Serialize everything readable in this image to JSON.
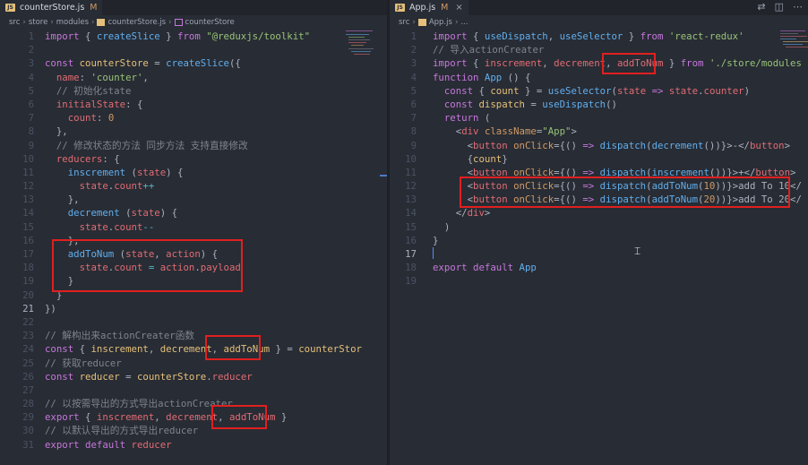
{
  "left": {
    "tab": {
      "badge": "JS",
      "filename": "counterStore.js",
      "modified": "M"
    },
    "breadcrumb": [
      "src",
      "store",
      "modules",
      "counterStore.js",
      "counterStore"
    ],
    "lines": [
      [
        [
          "k",
          "import"
        ],
        [
          "w",
          " { "
        ],
        [
          "f",
          "createSlice"
        ],
        [
          "w",
          " } "
        ],
        [
          "k",
          "from"
        ],
        [
          "w",
          " "
        ],
        [
          "s",
          "\"@reduxjs/toolkit\""
        ]
      ],
      [],
      [
        [
          "k",
          "const"
        ],
        [
          "w",
          " "
        ],
        [
          "y",
          "counterStore"
        ],
        [
          "w",
          " = "
        ],
        [
          "f",
          "createSlice"
        ],
        [
          "w",
          "({"
        ]
      ],
      [
        [
          "w",
          "  "
        ],
        [
          "p",
          "name"
        ],
        [
          "w",
          ": "
        ],
        [
          "s",
          "'counter'"
        ],
        [
          "w",
          ","
        ]
      ],
      [
        [
          "w",
          "  "
        ],
        [
          "c",
          "// 初始化state"
        ]
      ],
      [
        [
          "w",
          "  "
        ],
        [
          "p",
          "initialState"
        ],
        [
          "w",
          ": {"
        ]
      ],
      [
        [
          "w",
          "    "
        ],
        [
          "p",
          "count"
        ],
        [
          "w",
          ": "
        ],
        [
          "n",
          "0"
        ]
      ],
      [
        [
          "w",
          "  },"
        ]
      ],
      [
        [
          "w",
          "  "
        ],
        [
          "c",
          "// 修改状态的方法 同步方法 支持直接修改"
        ]
      ],
      [
        [
          "w",
          "  "
        ],
        [
          "p",
          "reducers"
        ],
        [
          "w",
          ": {"
        ]
      ],
      [
        [
          "w",
          "    "
        ],
        [
          "f",
          "inscrement"
        ],
        [
          "w",
          " ("
        ],
        [
          "p",
          "state"
        ],
        [
          "w",
          ") {"
        ]
      ],
      [
        [
          "w",
          "      "
        ],
        [
          "p",
          "state"
        ],
        [
          "w",
          "."
        ],
        [
          "p",
          "count"
        ],
        [
          "t",
          "++"
        ]
      ],
      [
        [
          "w",
          "    },"
        ]
      ],
      [
        [
          "w",
          "    "
        ],
        [
          "f",
          "decrement"
        ],
        [
          "w",
          " ("
        ],
        [
          "p",
          "state"
        ],
        [
          "w",
          ") {"
        ]
      ],
      [
        [
          "w",
          "      "
        ],
        [
          "p",
          "state"
        ],
        [
          "w",
          "."
        ],
        [
          "p",
          "count"
        ],
        [
          "t",
          "--"
        ]
      ],
      [
        [
          "w",
          "    },"
        ]
      ],
      [
        [
          "w",
          "    "
        ],
        [
          "f",
          "addToNum"
        ],
        [
          "w",
          " ("
        ],
        [
          "p",
          "state"
        ],
        [
          "w",
          ", "
        ],
        [
          "p",
          "action"
        ],
        [
          "w",
          ") {"
        ]
      ],
      [
        [
          "w",
          "      "
        ],
        [
          "p",
          "state"
        ],
        [
          "w",
          "."
        ],
        [
          "p",
          "count"
        ],
        [
          "w",
          " "
        ],
        [
          "t",
          "="
        ],
        [
          "w",
          " "
        ],
        [
          "p",
          "action"
        ],
        [
          "w",
          "."
        ],
        [
          "p",
          "payload"
        ]
      ],
      [
        [
          "w",
          "    }"
        ]
      ],
      [
        [
          "w",
          "  }"
        ]
      ],
      [
        [
          "w",
          "})"
        ]
      ],
      [],
      [
        [
          "c",
          "// 解构出来actionCreater函数"
        ]
      ],
      [
        [
          "k",
          "const"
        ],
        [
          "w",
          " { "
        ],
        [
          "y",
          "inscrement"
        ],
        [
          "w",
          ", "
        ],
        [
          "y",
          "decrement"
        ],
        [
          "w",
          ", "
        ],
        [
          "y",
          "addToNum"
        ],
        [
          "w",
          " } = "
        ],
        [
          "y",
          "counterStor"
        ]
      ],
      [
        [
          "c",
          "// 获取reducer"
        ]
      ],
      [
        [
          "k",
          "const"
        ],
        [
          "w",
          " "
        ],
        [
          "y",
          "reducer"
        ],
        [
          "w",
          " = "
        ],
        [
          "y",
          "counterStore"
        ],
        [
          "w",
          "."
        ],
        [
          "p",
          "reducer"
        ]
      ],
      [],
      [
        [
          "c",
          "// 以按需导出的方式导出actionCreater"
        ]
      ],
      [
        [
          "k",
          "export"
        ],
        [
          "w",
          " { "
        ],
        [
          "p",
          "inscrement"
        ],
        [
          "w",
          ", "
        ],
        [
          "p",
          "decrement"
        ],
        [
          "w",
          ", "
        ],
        [
          "p",
          "addToNum"
        ],
        [
          "w",
          " }"
        ]
      ],
      [
        [
          "c",
          "// 以默认导出的方式导出reducer"
        ]
      ],
      [
        [
          "k",
          "export"
        ],
        [
          "w",
          " "
        ],
        [
          "k",
          "default"
        ],
        [
          "w",
          " "
        ],
        [
          "p",
          "reducer"
        ]
      ]
    ],
    "current_line": 21
  },
  "right": {
    "tab": {
      "badge": "JS",
      "filename": "App.js",
      "modified": "M"
    },
    "breadcrumb": [
      "src",
      "App.js",
      "..."
    ],
    "lines": [
      [
        [
          "k",
          "import"
        ],
        [
          "w",
          " { "
        ],
        [
          "f",
          "useDispatch"
        ],
        [
          "w",
          ", "
        ],
        [
          "f",
          "useSelector"
        ],
        [
          "w",
          " } "
        ],
        [
          "k",
          "from"
        ],
        [
          "w",
          " "
        ],
        [
          "s",
          "'react-redux'"
        ]
      ],
      [
        [
          "c",
          "// 导入actionCreater"
        ]
      ],
      [
        [
          "k",
          "import"
        ],
        [
          "w",
          " { "
        ],
        [
          "p",
          "inscrement"
        ],
        [
          "w",
          ", "
        ],
        [
          "p",
          "decrement"
        ],
        [
          "w",
          ", "
        ],
        [
          "p",
          "addToNum"
        ],
        [
          "w",
          " } "
        ],
        [
          "k",
          "from"
        ],
        [
          "w",
          " "
        ],
        [
          "s",
          "'./store/modules"
        ]
      ],
      [
        [
          "k",
          "function"
        ],
        [
          "w",
          " "
        ],
        [
          "f",
          "App"
        ],
        [
          "w",
          " () {"
        ]
      ],
      [
        [
          "w",
          "  "
        ],
        [
          "k",
          "const"
        ],
        [
          "w",
          " { "
        ],
        [
          "y",
          "count"
        ],
        [
          "w",
          " } = "
        ],
        [
          "f",
          "useSelector"
        ],
        [
          "w",
          "("
        ],
        [
          "p",
          "state"
        ],
        [
          "w",
          " "
        ],
        [
          "k",
          "=>"
        ],
        [
          "w",
          " "
        ],
        [
          "p",
          "state"
        ],
        [
          "w",
          "."
        ],
        [
          "p",
          "counter"
        ],
        [
          "w",
          ")"
        ]
      ],
      [
        [
          "w",
          "  "
        ],
        [
          "k",
          "const"
        ],
        [
          "w",
          " "
        ],
        [
          "y",
          "dispatch"
        ],
        [
          "w",
          " = "
        ],
        [
          "f",
          "useDispatch"
        ],
        [
          "w",
          "()"
        ]
      ],
      [
        [
          "w",
          "  "
        ],
        [
          "k",
          "return"
        ],
        [
          "w",
          " ("
        ]
      ],
      [
        [
          "w",
          "    <"
        ],
        [
          "p",
          "div"
        ],
        [
          "w",
          " "
        ],
        [
          "n",
          "className"
        ],
        [
          "w",
          "="
        ],
        [
          "s",
          "\"App\""
        ],
        [
          "w",
          ">"
        ]
      ],
      [
        [
          "w",
          "      <"
        ],
        [
          "p",
          "button"
        ],
        [
          "w",
          " "
        ],
        [
          "n",
          "onClick"
        ],
        [
          "w",
          "={"
        ],
        [
          "w",
          "() "
        ],
        [
          "k",
          "=>"
        ],
        [
          "w",
          " "
        ],
        [
          "f",
          "dispatch"
        ],
        [
          "w",
          "("
        ],
        [
          "f",
          "decrement"
        ],
        [
          "w",
          "())}>-</"
        ],
        [
          "p",
          "button"
        ],
        [
          "w",
          ">"
        ]
      ],
      [
        [
          "w",
          "      {"
        ],
        [
          "y",
          "count"
        ],
        [
          "w",
          "}"
        ]
      ],
      [
        [
          "w",
          "      <"
        ],
        [
          "p",
          "button"
        ],
        [
          "w",
          " "
        ],
        [
          "n",
          "onClick"
        ],
        [
          "w",
          "={"
        ],
        [
          "w",
          "() "
        ],
        [
          "k",
          "=>"
        ],
        [
          "w",
          " "
        ],
        [
          "f",
          "dispatch"
        ],
        [
          "w",
          "("
        ],
        [
          "f",
          "inscrement"
        ],
        [
          "w",
          "())}>+</"
        ],
        [
          "p",
          "button"
        ],
        [
          "w",
          ">"
        ]
      ],
      [
        [
          "w",
          "      <"
        ],
        [
          "p",
          "button"
        ],
        [
          "w",
          " "
        ],
        [
          "n",
          "onClick"
        ],
        [
          "w",
          "={"
        ],
        [
          "w",
          "() "
        ],
        [
          "k",
          "=>"
        ],
        [
          "w",
          " "
        ],
        [
          "f",
          "dispatch"
        ],
        [
          "w",
          "("
        ],
        [
          "f",
          "addToNum"
        ],
        [
          "w",
          "("
        ],
        [
          "n",
          "10"
        ],
        [
          "w",
          "))}>add To 10</"
        ]
      ],
      [
        [
          "w",
          "      <"
        ],
        [
          "p",
          "button"
        ],
        [
          "w",
          " "
        ],
        [
          "n",
          "onClick"
        ],
        [
          "w",
          "={"
        ],
        [
          "w",
          "() "
        ],
        [
          "k",
          "=>"
        ],
        [
          "w",
          " "
        ],
        [
          "f",
          "dispatch"
        ],
        [
          "w",
          "("
        ],
        [
          "f",
          "addToNum"
        ],
        [
          "w",
          "("
        ],
        [
          "n",
          "20"
        ],
        [
          "w",
          "))}>add To 20</"
        ]
      ],
      [
        [
          "w",
          "    </"
        ],
        [
          "p",
          "div"
        ],
        [
          "w",
          ">"
        ]
      ],
      [
        [
          "w",
          "  )"
        ]
      ],
      [
        [
          "w",
          "}"
        ]
      ],
      [],
      [
        [
          "k",
          "export"
        ],
        [
          "w",
          " "
        ],
        [
          "k",
          "default"
        ],
        [
          "w",
          " "
        ],
        [
          "f",
          "App"
        ]
      ],
      []
    ],
    "current_line": 17
  },
  "colors": {
    "highlight_box": "#e02020",
    "editor_bg": "#282c34",
    "keyword": "#c678dd",
    "function": "#61afef",
    "string": "#98c379"
  }
}
